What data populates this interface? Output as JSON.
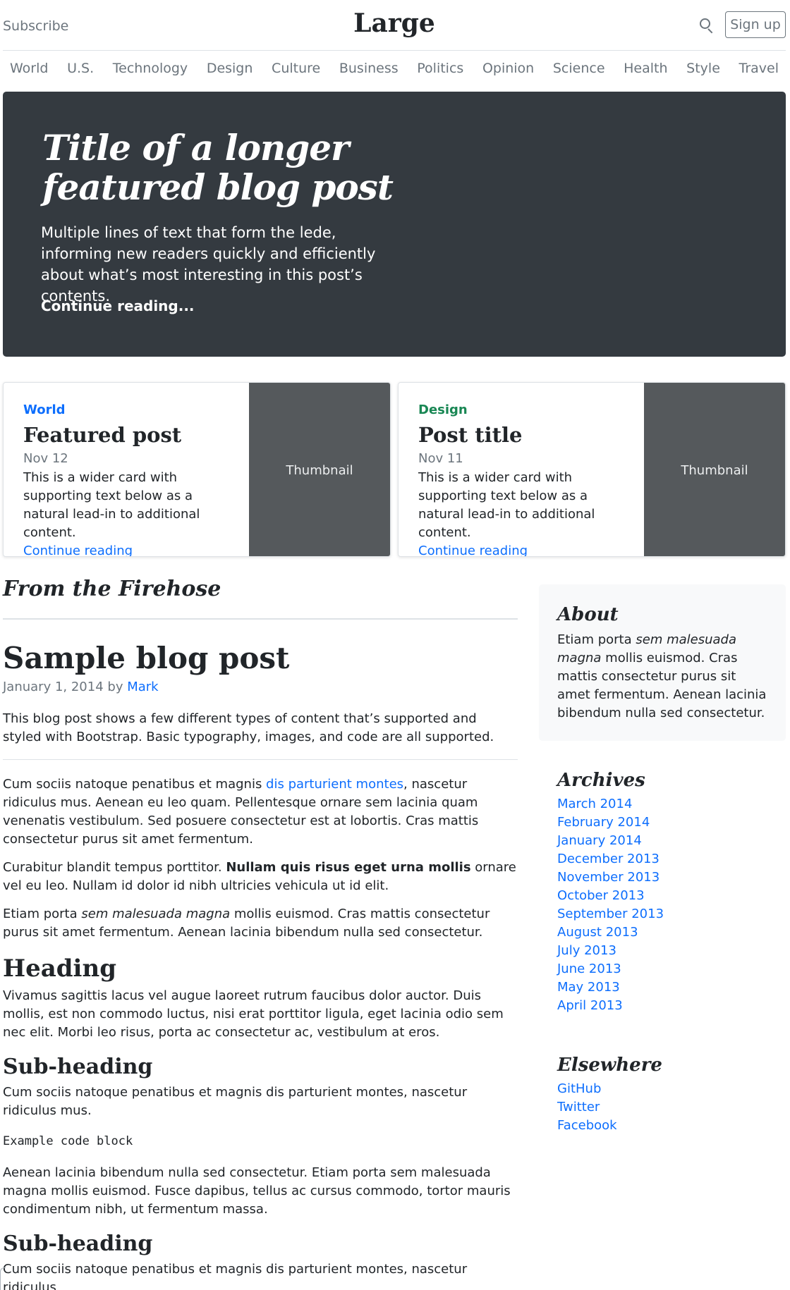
{
  "header": {
    "subscribe_label": "Subscribe",
    "brand": "Large",
    "signup_label": "Sign up"
  },
  "nav": [
    "World",
    "U.S.",
    "Technology",
    "Design",
    "Culture",
    "Business",
    "Politics",
    "Opinion",
    "Science",
    "Health",
    "Style",
    "Travel"
  ],
  "jumbotron": {
    "title_line1": "Title of a longer",
    "title_line2": "featured blog post",
    "lede": "Multiple lines of text that form the lede, informing new readers quickly and efficiently about what’s most interesting in this post’s contents.",
    "continue_label": "Continue reading..."
  },
  "cards": [
    {
      "category": "World",
      "category_color": "#0d6efd",
      "title": "Featured post",
      "date": "Nov 12",
      "text": "This is a wider card with supporting text below as a natural lead-in to additional content.",
      "continue_label": "Continue reading",
      "thumb_label": "Thumbnail"
    },
    {
      "category": "Design",
      "category_color": "#198754",
      "title": "Post title",
      "date": "Nov 11",
      "text": "This is a wider card with supporting text below as a natural lead-in to additional content.",
      "continue_label": "Continue reading",
      "thumb_label": "Thumbnail"
    }
  ],
  "main": {
    "section_title": "From the Firehose",
    "post": {
      "title": "Sample blog post",
      "date": "January 1, 2014",
      "by": "by",
      "author": "Mark",
      "intro": "This blog post shows a few different types of content that’s supported and styled with Bootstrap. Basic typography, images, and code are all supported.",
      "p1_start": "Cum sociis natoque penatibus et magnis ",
      "p1_link": "dis parturient montes",
      "p1_end": ", nascetur ridiculus mus. Aenean eu leo quam. Pellentesque ornare sem lacinia quam venenatis vestibulum. Sed posuere consectetur est at lobortis. Cras mattis consectetur purus sit amet fermentum.",
      "p2_start": "Curabitur blandit tempus porttitor. ",
      "p2_bold": "Nullam quis risus eget urna mollis",
      "p2_end": " ornare vel eu leo. Nullam id dolor id nibh ultricies vehicula ut id elit.",
      "p3_start": "Etiam porta ",
      "p3_em": "sem malesuada magna",
      "p3_end": " mollis euismod. Cras mattis consectetur purus sit amet fermentum. Aenean lacinia bibendum nulla sed consectetur.",
      "heading": "Heading",
      "p4": "Vivamus sagittis lacus vel augue laoreet rutrum faucibus dolor auctor. Duis mollis, est non commodo luctus, nisi erat porttitor ligula, eget lacinia odio sem nec elit. Morbi leo risus, porta ac consectetur ac, vestibulum at eros.",
      "subheading1": "Sub-heading",
      "p5": "Cum sociis natoque penatibus et magnis dis parturient montes, nascetur ridiculus mus.",
      "code": "Example code block",
      "p6": "Aenean lacinia bibendum nulla sed consectetur. Etiam porta sem malesuada magna mollis euismod. Fusce dapibus, tellus ac cursus commodo, tortor mauris condimentum nibh, ut fermentum massa.",
      "subheading2": "Sub-heading",
      "p7": "Cum sociis natoque penatibus et magnis dis parturient montes, nascetur ridiculus"
    }
  },
  "sidebar": {
    "about_title": "About",
    "about_start": "Etiam porta ",
    "about_em": "sem malesuada magna",
    "about_end": " mollis euismod. Cras mattis consectetur purus sit amet fermentum. Aenean lacinia bibendum nulla sed consectetur.",
    "archives_title": "Archives",
    "archives": [
      "March 2014",
      "February 2014",
      "January 2014",
      "December 2013",
      "November 2013",
      "October 2013",
      "September 2013",
      "August 2013",
      "July 2013",
      "June 2013",
      "May 2013",
      "April 2013"
    ],
    "elsewhere_title": "Elsewhere",
    "elsewhere": [
      "GitHub",
      "Twitter",
      "Facebook"
    ]
  }
}
